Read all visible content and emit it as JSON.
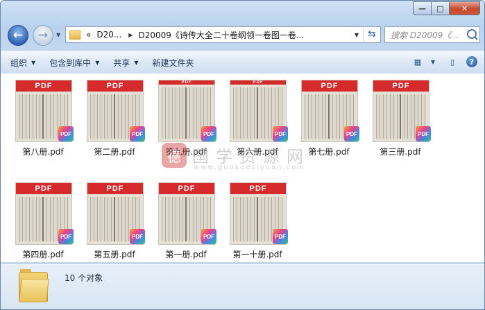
{
  "window": {
    "controls": {
      "minimize": "—",
      "maximize": "□",
      "close": "✕"
    }
  },
  "nav": {
    "back_icon": "back-arrow-icon",
    "forward_icon": "forward-arrow-icon",
    "breadcrumb": [
      "«",
      "D20...",
      "D20009《诗传大全二十卷纲领一卷图一卷..."
    ],
    "search_placeholder": "搜索 D20009《..."
  },
  "toolbar": {
    "organize": "组织",
    "include_library": "包含到库中",
    "share": "共享",
    "new_folder": "新建文件夹"
  },
  "files": [
    {
      "name": "第八册.pdf",
      "header": "PDF",
      "badge": "PDF"
    },
    {
      "name": "第二册.pdf",
      "header": "PDF",
      "badge": "PDF"
    },
    {
      "name": "第九册.pdf",
      "header": "PDF",
      "badge": "PDF"
    },
    {
      "name": "第六册.pdf",
      "header": "PDF",
      "badge": "PDF"
    },
    {
      "name": "第七册.pdf",
      "header": "PDF",
      "badge": "PDF"
    },
    {
      "name": "第三册.pdf",
      "header": "PDF",
      "badge": "PDF"
    },
    {
      "name": "第四册.pdf",
      "header": "PDF",
      "badge": "PDF"
    },
    {
      "name": "第五册.pdf",
      "header": "PDF",
      "badge": "PDF"
    },
    {
      "name": "第一册.pdf",
      "header": "PDF",
      "badge": "PDF"
    },
    {
      "name": "第一十册.pdf",
      "header": "PDF",
      "badge": "PDF"
    }
  ],
  "watermark": {
    "seal": "德",
    "text": "国学资源网",
    "url": "www.guoxueziyuan.com"
  },
  "status": {
    "count": "10 个对象"
  },
  "colors": {
    "pdf_header": "#d62a2c",
    "chrome": "#c3d8f0"
  }
}
